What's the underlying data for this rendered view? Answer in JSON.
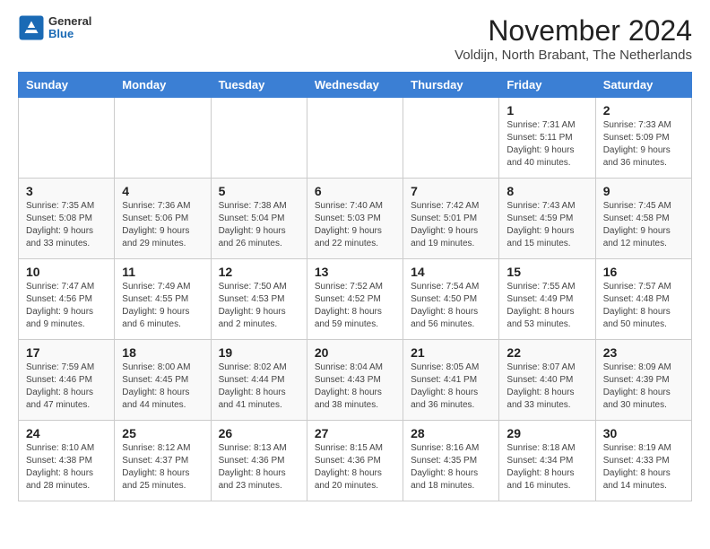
{
  "logo": {
    "general": "General",
    "blue": "Blue"
  },
  "title": "November 2024",
  "location": "Voldijn, North Brabant, The Netherlands",
  "days_of_week": [
    "Sunday",
    "Monday",
    "Tuesday",
    "Wednesday",
    "Thursday",
    "Friday",
    "Saturday"
  ],
  "weeks": [
    [
      {
        "day": "",
        "detail": ""
      },
      {
        "day": "",
        "detail": ""
      },
      {
        "day": "",
        "detail": ""
      },
      {
        "day": "",
        "detail": ""
      },
      {
        "day": "",
        "detail": ""
      },
      {
        "day": "1",
        "detail": "Sunrise: 7:31 AM\nSunset: 5:11 PM\nDaylight: 9 hours\nand 40 minutes."
      },
      {
        "day": "2",
        "detail": "Sunrise: 7:33 AM\nSunset: 5:09 PM\nDaylight: 9 hours\nand 36 minutes."
      }
    ],
    [
      {
        "day": "3",
        "detail": "Sunrise: 7:35 AM\nSunset: 5:08 PM\nDaylight: 9 hours\nand 33 minutes."
      },
      {
        "day": "4",
        "detail": "Sunrise: 7:36 AM\nSunset: 5:06 PM\nDaylight: 9 hours\nand 29 minutes."
      },
      {
        "day": "5",
        "detail": "Sunrise: 7:38 AM\nSunset: 5:04 PM\nDaylight: 9 hours\nand 26 minutes."
      },
      {
        "day": "6",
        "detail": "Sunrise: 7:40 AM\nSunset: 5:03 PM\nDaylight: 9 hours\nand 22 minutes."
      },
      {
        "day": "7",
        "detail": "Sunrise: 7:42 AM\nSunset: 5:01 PM\nDaylight: 9 hours\nand 19 minutes."
      },
      {
        "day": "8",
        "detail": "Sunrise: 7:43 AM\nSunset: 4:59 PM\nDaylight: 9 hours\nand 15 minutes."
      },
      {
        "day": "9",
        "detail": "Sunrise: 7:45 AM\nSunset: 4:58 PM\nDaylight: 9 hours\nand 12 minutes."
      }
    ],
    [
      {
        "day": "10",
        "detail": "Sunrise: 7:47 AM\nSunset: 4:56 PM\nDaylight: 9 hours\nand 9 minutes."
      },
      {
        "day": "11",
        "detail": "Sunrise: 7:49 AM\nSunset: 4:55 PM\nDaylight: 9 hours\nand 6 minutes."
      },
      {
        "day": "12",
        "detail": "Sunrise: 7:50 AM\nSunset: 4:53 PM\nDaylight: 9 hours\nand 2 minutes."
      },
      {
        "day": "13",
        "detail": "Sunrise: 7:52 AM\nSunset: 4:52 PM\nDaylight: 8 hours\nand 59 minutes."
      },
      {
        "day": "14",
        "detail": "Sunrise: 7:54 AM\nSunset: 4:50 PM\nDaylight: 8 hours\nand 56 minutes."
      },
      {
        "day": "15",
        "detail": "Sunrise: 7:55 AM\nSunset: 4:49 PM\nDaylight: 8 hours\nand 53 minutes."
      },
      {
        "day": "16",
        "detail": "Sunrise: 7:57 AM\nSunset: 4:48 PM\nDaylight: 8 hours\nand 50 minutes."
      }
    ],
    [
      {
        "day": "17",
        "detail": "Sunrise: 7:59 AM\nSunset: 4:46 PM\nDaylight: 8 hours\nand 47 minutes."
      },
      {
        "day": "18",
        "detail": "Sunrise: 8:00 AM\nSunset: 4:45 PM\nDaylight: 8 hours\nand 44 minutes."
      },
      {
        "day": "19",
        "detail": "Sunrise: 8:02 AM\nSunset: 4:44 PM\nDaylight: 8 hours\nand 41 minutes."
      },
      {
        "day": "20",
        "detail": "Sunrise: 8:04 AM\nSunset: 4:43 PM\nDaylight: 8 hours\nand 38 minutes."
      },
      {
        "day": "21",
        "detail": "Sunrise: 8:05 AM\nSunset: 4:41 PM\nDaylight: 8 hours\nand 36 minutes."
      },
      {
        "day": "22",
        "detail": "Sunrise: 8:07 AM\nSunset: 4:40 PM\nDaylight: 8 hours\nand 33 minutes."
      },
      {
        "day": "23",
        "detail": "Sunrise: 8:09 AM\nSunset: 4:39 PM\nDaylight: 8 hours\nand 30 minutes."
      }
    ],
    [
      {
        "day": "24",
        "detail": "Sunrise: 8:10 AM\nSunset: 4:38 PM\nDaylight: 8 hours\nand 28 minutes."
      },
      {
        "day": "25",
        "detail": "Sunrise: 8:12 AM\nSunset: 4:37 PM\nDaylight: 8 hours\nand 25 minutes."
      },
      {
        "day": "26",
        "detail": "Sunrise: 8:13 AM\nSunset: 4:36 PM\nDaylight: 8 hours\nand 23 minutes."
      },
      {
        "day": "27",
        "detail": "Sunrise: 8:15 AM\nSunset: 4:36 PM\nDaylight: 8 hours\nand 20 minutes."
      },
      {
        "day": "28",
        "detail": "Sunrise: 8:16 AM\nSunset: 4:35 PM\nDaylight: 8 hours\nand 18 minutes."
      },
      {
        "day": "29",
        "detail": "Sunrise: 8:18 AM\nSunset: 4:34 PM\nDaylight: 8 hours\nand 16 minutes."
      },
      {
        "day": "30",
        "detail": "Sunrise: 8:19 AM\nSunset: 4:33 PM\nDaylight: 8 hours\nand 14 minutes."
      }
    ]
  ]
}
